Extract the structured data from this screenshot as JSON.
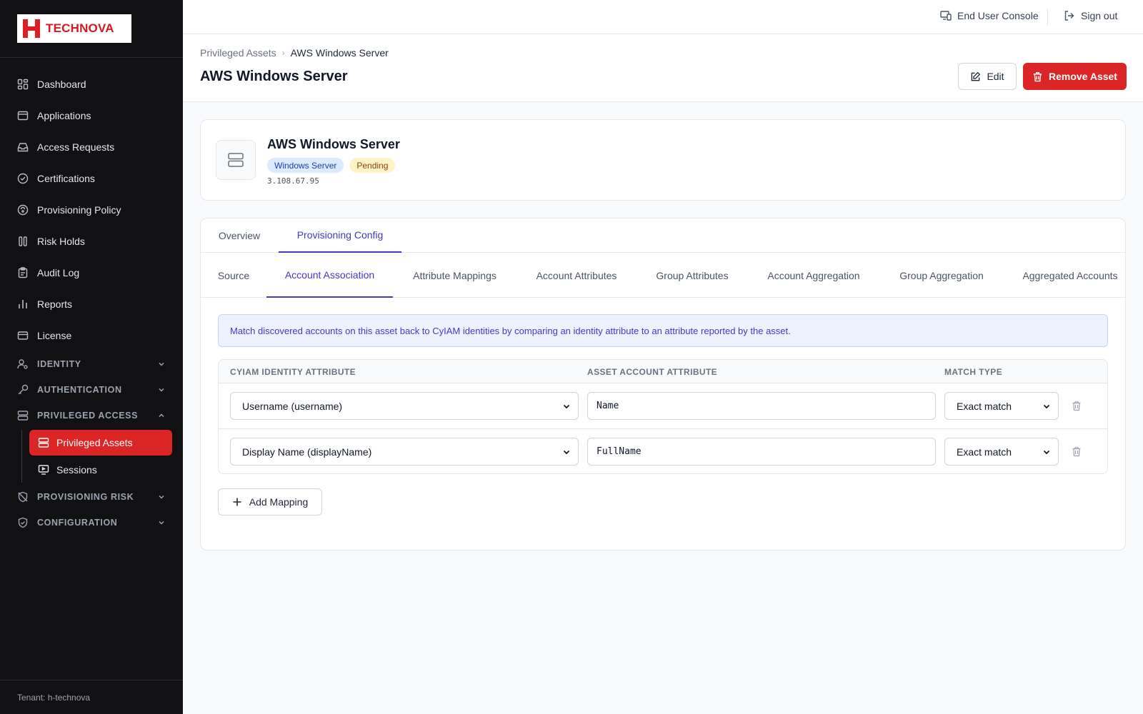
{
  "brand": {
    "name": "TECHNOVA",
    "accent": "#dc2626"
  },
  "sidebar": {
    "items": [
      {
        "label": "Dashboard",
        "icon": "dashboard-icon"
      },
      {
        "label": "Applications",
        "icon": "applications-icon"
      },
      {
        "label": "Access Requests",
        "icon": "inbox-icon"
      },
      {
        "label": "Certifications",
        "icon": "check-circle-icon"
      },
      {
        "label": "Provisioning Policy",
        "icon": "policy-icon"
      },
      {
        "label": "Risk Holds",
        "icon": "pause-icon"
      },
      {
        "label": "Audit Log",
        "icon": "clipboard-icon"
      },
      {
        "label": "Reports",
        "icon": "bar-chart-icon"
      },
      {
        "label": "License",
        "icon": "card-icon"
      }
    ],
    "sections": [
      {
        "label": "IDENTITY",
        "icon": "user-cog-icon",
        "expanded": false
      },
      {
        "label": "AUTHENTICATION",
        "icon": "key-icon",
        "expanded": false
      },
      {
        "label": "PRIVILEGED ACCESS",
        "icon": "server-icon",
        "expanded": true
      },
      {
        "label": "PROVISIONING RISK",
        "icon": "shield-off-icon",
        "expanded": false
      },
      {
        "label": "CONFIGURATION",
        "icon": "shield-check-icon",
        "expanded": false
      }
    ],
    "privileged_sub": [
      {
        "label": "Privileged Assets",
        "icon": "server-icon",
        "active": true
      },
      {
        "label": "Sessions",
        "icon": "monitor-icon",
        "active": false
      }
    ],
    "tenant": "Tenant: h-technova"
  },
  "topbar": {
    "console_label": "End User Console",
    "signout_label": "Sign out"
  },
  "header": {
    "breadcrumb": [
      "Privileged Assets",
      "AWS Windows Server"
    ],
    "title": "AWS Windows Server",
    "edit_label": "Edit",
    "remove_label": "Remove Asset"
  },
  "asset": {
    "name": "AWS Windows Server",
    "type_badge": "Windows Server",
    "status_badge": "Pending",
    "ip": "3.108.67.95"
  },
  "tabs": [
    {
      "label": "Overview",
      "active": false
    },
    {
      "label": "Provisioning Config",
      "active": true
    }
  ],
  "subtabs": [
    {
      "label": "Source",
      "active": false
    },
    {
      "label": "Account Association",
      "active": true
    },
    {
      "label": "Attribute Mappings",
      "active": false
    },
    {
      "label": "Account Attributes",
      "active": false
    },
    {
      "label": "Group Attributes",
      "active": false
    },
    {
      "label": "Account Aggregation",
      "active": false
    },
    {
      "label": "Group Aggregation",
      "active": false
    },
    {
      "label": "Aggregated Accounts",
      "active": false
    }
  ],
  "info_text": "Match discovered accounts on this asset back to CyIAM identities by comparing an identity attribute to an attribute reported by the asset.",
  "mapping": {
    "columns": [
      "CYIAM IDENTITY ATTRIBUTE",
      "ASSET ACCOUNT ATTRIBUTE",
      "MATCH TYPE"
    ],
    "rows": [
      {
        "identity_attr": "Username (username)",
        "asset_attr": "Name",
        "match_type": "Exact match"
      },
      {
        "identity_attr": "Display Name (displayName)",
        "asset_attr": "FullName",
        "match_type": "Exact match"
      }
    ],
    "add_label": "Add Mapping"
  }
}
